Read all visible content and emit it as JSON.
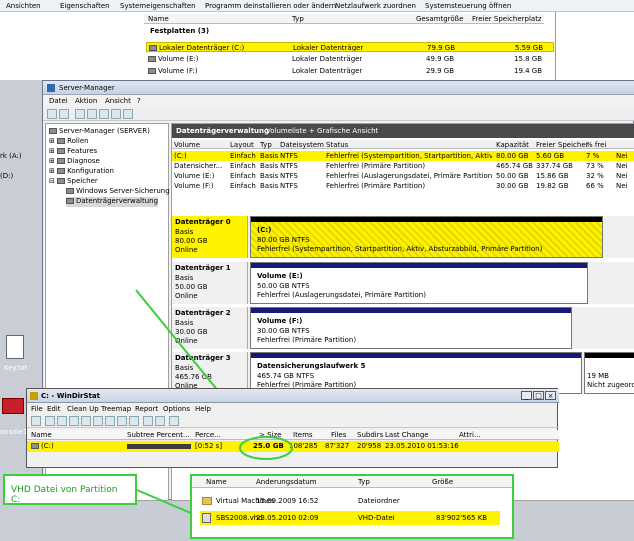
{
  "explorer": {
    "toolbar": [
      "Ansichten",
      "Eigenschaften",
      "Systemeigenschaften",
      "Programm deinstallieren oder ändern",
      "Netzlaufwerk zuordnen",
      "Systemsteuerung öffnen"
    ],
    "columns": [
      "Name",
      "Typ",
      "Gesamtgröße",
      "Freier Speicherplatz"
    ],
    "group": "Festplatten (3)",
    "rows": [
      {
        "name": "Lokaler Datenträger (C:)",
        "type": "Lokaler Datenträger",
        "total": "79.9 GB",
        "free": "5.59 GB"
      },
      {
        "name": "Volume (E:)",
        "type": "Lokaler Datenträger",
        "total": "49.9 GB",
        "free": "15.8 GB"
      },
      {
        "name": "Volume (F:)",
        "type": "Lokaler Datenträger",
        "total": "29.9 GB",
        "free": "19.4 GB"
      }
    ]
  },
  "desktop": {
    "side1": "rk (A:)",
    "side2": "(D:)",
    "key_label": "Key.txt",
    "console_label": "onsole1"
  },
  "server_manager": {
    "title": "Server-Manager",
    "menu": [
      "Datei",
      "Aktion",
      "Ansicht",
      "?"
    ],
    "tree": [
      "Server-Manager (SERVER)",
      "Rollen",
      "Features",
      "Diagnose",
      "Konfiguration",
      "Speicher",
      "Windows Server-Sicherung",
      "Datenträgerverwaltung"
    ],
    "main_title": "Datenträgerverwaltung",
    "main_subtitle": "Volumeliste + Grafische Ansicht",
    "vol_columns": [
      "Volume",
      "Layout",
      "Typ",
      "Dateisystem",
      "Status",
      "Kapazität",
      "Freier Speicher",
      "% frei"
    ],
    "volumes": [
      {
        "vol": "(C:)",
        "layout": "Einfach",
        "typ": "Basis",
        "fs": "NTFS",
        "status": "Fehlerfrei (Systempartition, Startpartition, Aktiv, Abs...",
        "cap": "80.00 GB",
        "free": "5.60 GB",
        "pct": "7 %",
        "more": "Nei"
      },
      {
        "vol": "Datensicher...",
        "layout": "Einfach",
        "typ": "Basis",
        "fs": "NTFS",
        "status": "Fehlerfrei (Primäre Partition)",
        "cap": "465.74 GB",
        "free": "337.74 GB",
        "pct": "73 %",
        "more": "Nei"
      },
      {
        "vol": "Volume (E:)",
        "layout": "Einfach",
        "typ": "Basis",
        "fs": "NTFS",
        "status": "Fehlerfrei (Auslagerungsdatei, Primäre Partition)",
        "cap": "50.00 GB",
        "free": "15.86 GB",
        "pct": "32 %",
        "more": "Nei"
      },
      {
        "vol": "Volume (F:)",
        "layout": "Einfach",
        "typ": "Basis",
        "fs": "NTFS",
        "status": "Fehlerfrei (Primäre Partition)",
        "cap": "30.00 GB",
        "free": "19.82 GB",
        "pct": "66 %",
        "more": "Nei"
      }
    ],
    "disks": [
      {
        "name": "Datenträger 0",
        "type": "Basis",
        "size": "80.00 GB",
        "state": "Online",
        "p_name": "(C:)",
        "p_size": "80.00 GB NTFS",
        "p_status": "Fehlerfrei (Systempartition, Startpartition, Aktiv, Absturzabbild, Primäre Partition)"
      },
      {
        "name": "Datenträger 1",
        "type": "Basis",
        "size": "50.00 GB",
        "state": "Online",
        "p_name": "Volume  (E:)",
        "p_size": "50.00 GB NTFS",
        "p_status": "Fehlerfrei (Auslagerungsdatei, Primäre Partition)"
      },
      {
        "name": "Datenträger 2",
        "type": "Basis",
        "size": "30.00 GB",
        "state": "Online",
        "p_name": "Volume  (F:)",
        "p_size": "30.00 GB NTFS",
        "p_status": "Fehlerfrei (Primäre Partition)"
      },
      {
        "name": "Datenträger 3",
        "type": "Basis",
        "size": "465.76 GB",
        "state": "Online",
        "p_name": "Datensicherungslaufwerk 5",
        "p_size": "465.74 GB NTFS",
        "p_status": "Fehlerfrei (Primäre Partition)",
        "extra1": "19 MB",
        "extra2": "Nicht zugeord"
      }
    ]
  },
  "windirstat": {
    "title": "C: - WinDirStat",
    "menu": [
      "File",
      "Edit",
      "Clean Up",
      "Treemap",
      "Report",
      "Options",
      "Help"
    ],
    "columns": [
      "Name",
      "Subtree Percent...",
      "Perce...",
      "> Size",
      "Items",
      "Files",
      "Subdirs",
      "Last Change",
      "Attri..."
    ],
    "row": {
      "name": "(C:)",
      "perce": "[0:52 s]",
      "size": "25.0 GB",
      "items": "108'285",
      "files": "87'327",
      "subdirs": "20'958",
      "last": "23.05.2010  01:53:16"
    }
  },
  "explorer_bottom": {
    "columns": [
      "Name",
      "Änderungsdatum",
      "Typ",
      "Größe"
    ],
    "rows": [
      {
        "name": "Virtual Machines",
        "date": "15.09.2009 16:52",
        "type": "Dateiordner",
        "size": ""
      },
      {
        "name": "SBS2008.vhd",
        "date": "23.05.2010 02:09",
        "type": "VHD-Datei",
        "size": "83'902'565 KB"
      }
    ]
  },
  "annotation": {
    "text": "VHD Datei von Partition C:"
  },
  "colors": {
    "highlight": "#fff200",
    "annotation": "#3ccf3c",
    "disk_bar": "#141a7a"
  }
}
